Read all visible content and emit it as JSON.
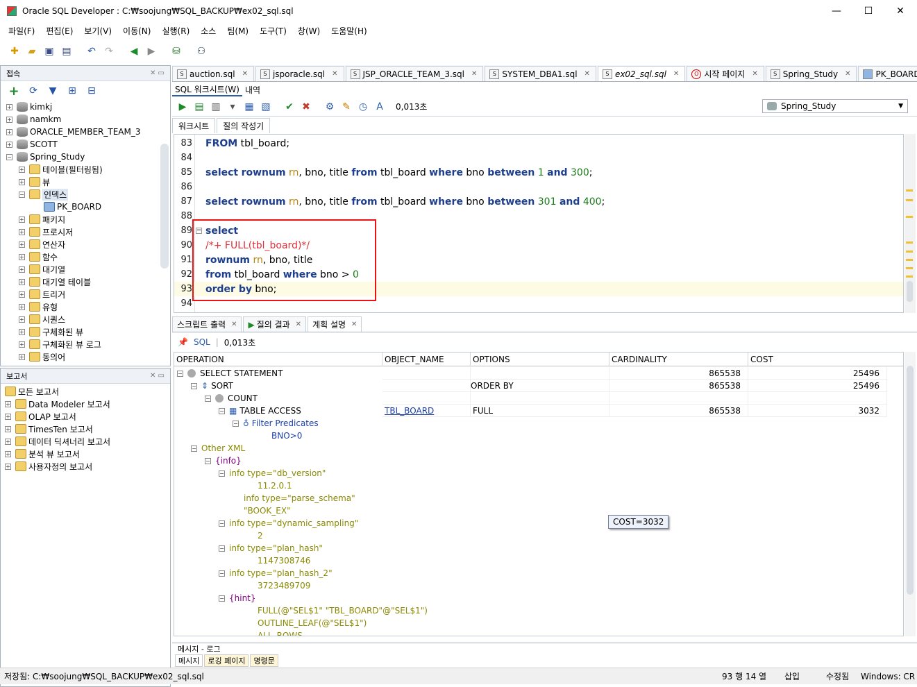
{
  "window": {
    "title": "Oracle SQL Developer : C:₩soojung₩SQL_BACKUP₩ex02_sql.sql",
    "min": "—",
    "max": "☐",
    "close": "✕"
  },
  "menu": [
    "파일(F)",
    "편집(E)",
    "보기(V)",
    "이동(N)",
    "실행(R)",
    "소스",
    "팀(M)",
    "도구(T)",
    "창(W)",
    "도움말(H)"
  ],
  "connections_panel": {
    "title": "접속",
    "items": [
      "kimkj",
      "namkm",
      "ORACLE_MEMBER_TEAM_3",
      "SCOTT",
      "Spring_Study"
    ],
    "children": [
      "테이블(필터링됨)",
      "뷰",
      "인덱스",
      "패키지",
      "프로시저",
      "연산자",
      "함수",
      "대기열",
      "대기열 테이블",
      "트리거",
      "유형",
      "시퀀스",
      "구체화된 뷰",
      "구체화된 뷰 로그",
      "동의어"
    ],
    "index_child": "PK_BOARD"
  },
  "reports_panel": {
    "title": "보고서",
    "items": [
      "모든 보고서",
      "Data Modeler 보고서",
      "OLAP 보고서",
      "TimesTen 보고서",
      "데이터 딕셔너리 보고서",
      "분석 뷰 보고서",
      "사용자정의 보고서"
    ]
  },
  "tabs": [
    "auction.sql",
    "jsporacle.sql",
    "JSP_ORACLE_TEAM_3.sql",
    "SYSTEM_DBA1.sql",
    "ex02_sql.sql",
    "시작 페이지",
    "Spring_Study",
    "PK_BOARD"
  ],
  "subtabs": [
    "SQL 워크시트(W)",
    "내역"
  ],
  "exec_time": "0,013초",
  "connection": "Spring_Study",
  "editor_tabs": [
    "워크시트",
    "질의 작성기"
  ],
  "editor": {
    "line_numbers": [
      "83",
      "84",
      "85",
      "86",
      "87",
      "88",
      "89",
      "90",
      "91",
      "92",
      "93",
      "94"
    ]
  },
  "output_tabs": [
    "스크립트 출력",
    "질의 결과",
    "계획 설명"
  ],
  "plan_bar": {
    "label": "SQL",
    "time": "0,013초"
  },
  "grid": {
    "headers": [
      "OPERATION",
      "OBJECT_NAME",
      "OPTIONS",
      "CARDINALITY",
      "COST"
    ],
    "rows": [
      {
        "op": "SELECT STATEMENT",
        "obj": "",
        "opt": "",
        "card": "865538",
        "cost": "25496"
      },
      {
        "op": "SORT",
        "obj": "",
        "opt": "ORDER BY",
        "card": "865538",
        "cost": "25496"
      },
      {
        "op": "COUNT",
        "obj": "",
        "opt": "",
        "card": "",
        "cost": ""
      },
      {
        "op": "TABLE ACCESS",
        "obj": "TBL_BOARD",
        "opt": "FULL",
        "card": "865538",
        "cost": "3032"
      }
    ],
    "filter": "Filter Predicates",
    "predicate": "BNO>0",
    "other_xml": "Other XML",
    "info": "{info}",
    "xml": [
      "info type=\"db_version\"",
      "11.2.0.1",
      "info type=\"parse_schema\"",
      "\"BOOK_EX\"",
      "info type=\"dynamic_sampling\"",
      "2",
      "info type=\"plan_hash\"",
      "1147308746",
      "info type=\"plan_hash_2\"",
      "3723489709",
      "{hint}",
      "FULL(@\"SEL$1\" \"TBL_BOARD\"@\"SEL$1\")",
      "OUTLINE_LEAF(@\"SEL$1\")",
      "ALL_ROWS"
    ]
  },
  "tooltip": "COST=3032",
  "messages": {
    "title": "메시지 - 로그",
    "tabs": [
      "메시지",
      "로깅 페이지",
      "명령문"
    ]
  },
  "status": {
    "saved": "저장됨: C:₩soojung₩SQL_BACKUP₩ex02_sql.sql",
    "pos": "93 행 14 열",
    "mode": "삽입",
    "edit": "수정됨",
    "os": "Windows: CR"
  }
}
